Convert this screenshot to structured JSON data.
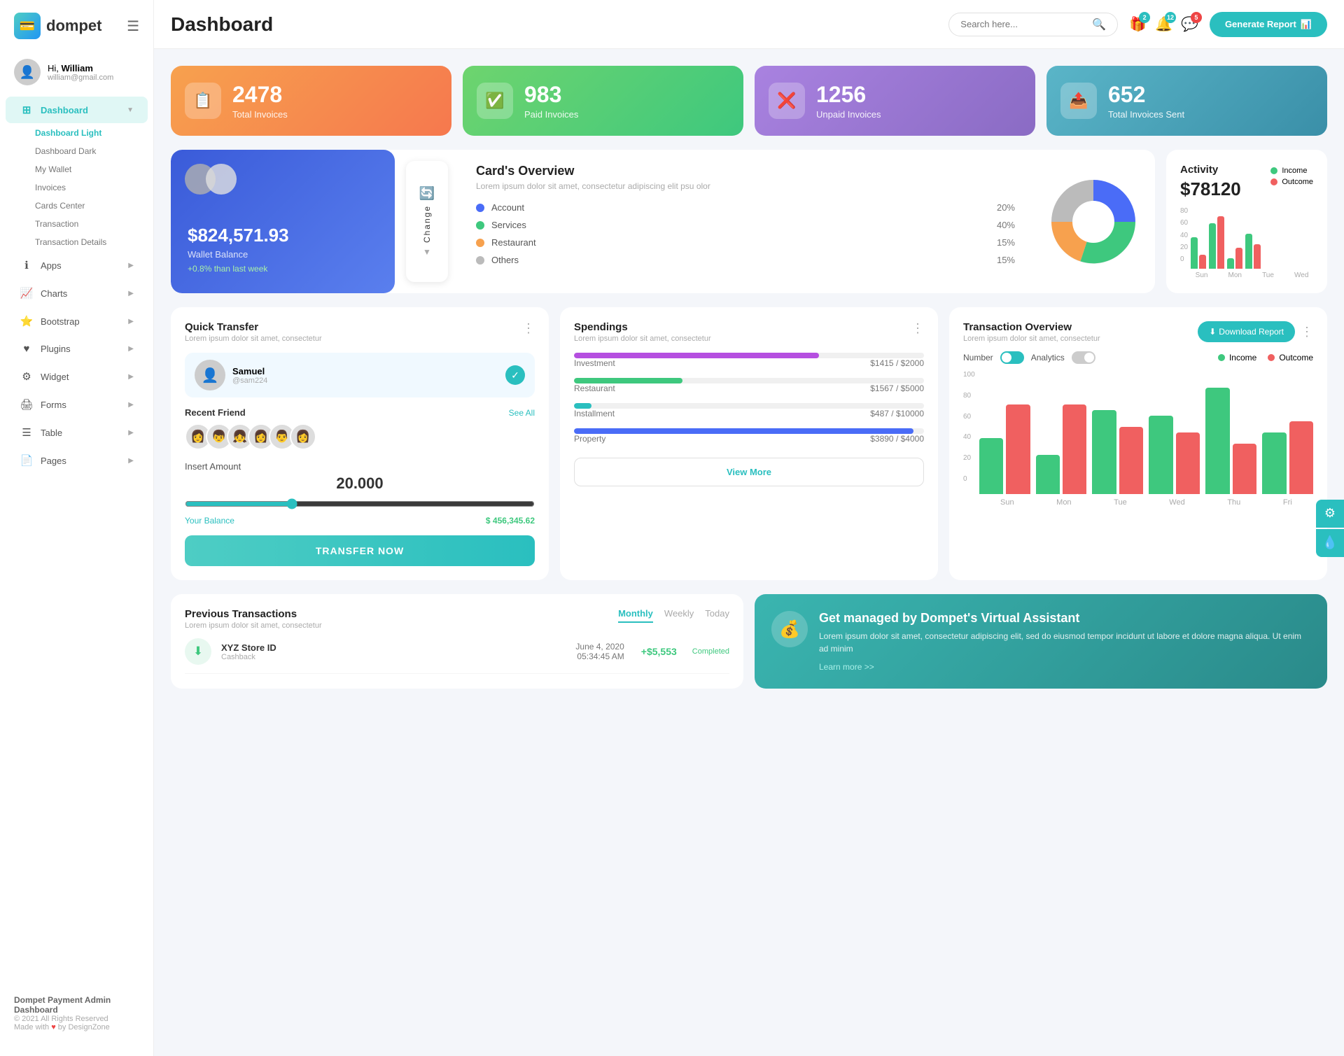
{
  "logo": {
    "text": "dompet",
    "icon": "💳"
  },
  "hamburger": "☰",
  "user": {
    "greeting": "Hi,",
    "name": "William",
    "email": "william@gmail.com",
    "avatar": "👤"
  },
  "sidebar": {
    "nav": [
      {
        "id": "dashboard",
        "label": "Dashboard",
        "icon": "⊞",
        "active": true,
        "arrow": "▼"
      },
      {
        "id": "dashboard-light",
        "label": "Dashboard Light",
        "sub": true,
        "active": true
      },
      {
        "id": "dashboard-dark",
        "label": "Dashboard Dark",
        "sub": true
      },
      {
        "id": "my-wallet",
        "label": "My Wallet",
        "sub": true
      },
      {
        "id": "invoices",
        "label": "Invoices",
        "sub": true
      },
      {
        "id": "cards-center",
        "label": "Cards Center",
        "sub": true
      },
      {
        "id": "transaction",
        "label": "Transaction",
        "sub": true
      },
      {
        "id": "transaction-details",
        "label": "Transaction Details",
        "sub": true
      },
      {
        "id": "apps",
        "label": "Apps",
        "icon": "ℹ",
        "arrow": "▶"
      },
      {
        "id": "charts",
        "label": "Charts",
        "icon": "📈",
        "arrow": "▶"
      },
      {
        "id": "bootstrap",
        "label": "Bootstrap",
        "icon": "⭐",
        "arrow": "▶"
      },
      {
        "id": "plugins",
        "label": "Plugins",
        "icon": "♥",
        "arrow": "▶"
      },
      {
        "id": "widget",
        "label": "Widget",
        "icon": "⚙",
        "arrow": "▶"
      },
      {
        "id": "forms",
        "label": "Forms",
        "icon": "🖨",
        "arrow": "▶"
      },
      {
        "id": "table",
        "label": "Table",
        "icon": "☰",
        "arrow": "▶"
      },
      {
        "id": "pages",
        "label": "Pages",
        "icon": "📄",
        "arrow": "▶"
      }
    ],
    "footer": {
      "title": "Dompet Payment Admin Dashboard",
      "copy": "© 2021 All Rights Reserved",
      "made": "Made with",
      "heart": "♥",
      "by": "by DesignZone"
    }
  },
  "topbar": {
    "title": "Dashboard",
    "search_placeholder": "Search here...",
    "search_icon": "🔍",
    "icons": [
      {
        "id": "gift",
        "icon": "🎁",
        "badge": "2",
        "badge_type": "teal"
      },
      {
        "id": "bell",
        "icon": "🔔",
        "badge": "12",
        "badge_type": "teal"
      },
      {
        "id": "chat",
        "icon": "💬",
        "badge": "5",
        "badge_type": "red"
      }
    ],
    "generate_btn": "Generate Report",
    "generate_icon": "📊"
  },
  "stats": [
    {
      "id": "total-invoices",
      "number": "2478",
      "label": "Total Invoices",
      "icon": "📋",
      "color": "orange"
    },
    {
      "id": "paid-invoices",
      "number": "983",
      "label": "Paid Invoices",
      "icon": "✅",
      "color": "green"
    },
    {
      "id": "unpaid-invoices",
      "number": "1256",
      "label": "Unpaid Invoices",
      "icon": "❌",
      "color": "purple"
    },
    {
      "id": "total-sent",
      "number": "652",
      "label": "Total Invoices Sent",
      "icon": "📤",
      "color": "teal"
    }
  ],
  "wallet": {
    "amount": "$824,571.93",
    "label": "Wallet Balance",
    "trend": "+0.8% than last week",
    "change_btn": "Change"
  },
  "cards_overview": {
    "title": "Card's Overview",
    "desc": "Lorem ipsum dolor sit amet, consectetur adipiscing elit psu olor",
    "items": [
      {
        "label": "Account",
        "pct": "20%",
        "color": "blue"
      },
      {
        "label": "Services",
        "pct": "40%",
        "color": "green"
      },
      {
        "label": "Restaurant",
        "pct": "15%",
        "color": "orange"
      },
      {
        "label": "Others",
        "pct": "15%",
        "color": "gray"
      }
    ]
  },
  "activity": {
    "title": "Activity",
    "amount": "$78120",
    "income_label": "Income",
    "outcome_label": "Outcome",
    "bars": [
      {
        "day": "Sun",
        "income": 45,
        "outcome": 20
      },
      {
        "day": "Mon",
        "income": 65,
        "outcome": 75
      },
      {
        "day": "Tue",
        "income": 15,
        "outcome": 30
      },
      {
        "day": "Wed",
        "income": 50,
        "outcome": 35
      }
    ],
    "y_labels": [
      "80",
      "60",
      "40",
      "20",
      "0"
    ]
  },
  "quick_transfer": {
    "title": "Quick Transfer",
    "desc": "Lorem ipsum dolor sit amet, consectetur",
    "user": {
      "name": "Samuel",
      "id": "@sam224",
      "avatar": "👤"
    },
    "recent_friends_label": "Recent Friend",
    "see_more": "See All",
    "friends": [
      "👩",
      "👦",
      "👧",
      "👩",
      "👨",
      "👩"
    ],
    "insert_amount_label": "Insert Amount",
    "amount": "20.000",
    "balance_label": "Your Balance",
    "balance_value": "$ 456,345.62",
    "transfer_btn": "TRANSFER NOW"
  },
  "spendings": {
    "title": "Spendings",
    "desc": "Lorem ipsum dolor sit amet, consectetur",
    "items": [
      {
        "label": "Investment",
        "amount": "$1415",
        "max": "$2000",
        "pct": 70,
        "color": "#b54fe0"
      },
      {
        "label": "Restaurant",
        "amount": "$1567",
        "max": "$5000",
        "pct": 31,
        "color": "#3ec87e"
      },
      {
        "label": "Installment",
        "amount": "$487",
        "max": "$10000",
        "pct": 5,
        "color": "#2abfbf"
      },
      {
        "label": "Property",
        "amount": "$3890",
        "max": "$4000",
        "pct": 97,
        "color": "#4a6cf7"
      }
    ],
    "view_more": "View More"
  },
  "transaction_overview": {
    "title": "Transaction Overview",
    "desc": "Lorem ipsum dolor sit amet, consectetur",
    "download_btn": "Download Report",
    "number_label": "Number",
    "analytics_label": "Analytics",
    "income_label": "Income",
    "outcome_label": "Outcome",
    "bars": [
      {
        "day": "Sun",
        "income": 50,
        "outcome": 80
      },
      {
        "day": "Mon",
        "income": 35,
        "outcome": 80
      },
      {
        "day": "Tue",
        "income": 75,
        "outcome": 60
      },
      {
        "day": "Wed",
        "income": 70,
        "outcome": 55
      },
      {
        "day": "Thu",
        "income": 95,
        "outcome": 45
      },
      {
        "day": "Fri",
        "income": 55,
        "outcome": 65
      }
    ],
    "y_labels": [
      "100",
      "80",
      "60",
      "40",
      "20",
      "0"
    ]
  },
  "prev_transactions": {
    "title": "Previous Transactions",
    "desc": "Lorem ipsum dolor sit amet, consectetur",
    "tabs": [
      "Monthly",
      "Weekly",
      "Today"
    ],
    "active_tab": "Monthly",
    "rows": [
      {
        "name": "XYZ Store ID",
        "type": "Cashback",
        "date": "June 4, 2020",
        "time": "05:34:45 AM",
        "amount": "+$5,553",
        "status": "Completed",
        "icon": "⬇"
      }
    ]
  },
  "virtual_assistant": {
    "title": "Get managed by Dompet's Virtual Assistant",
    "desc": "Lorem ipsum dolor sit amet, consectetur adipiscing elit, sed do eiusmod tempor incidunt ut labore et dolore magna aliqua. Ut enim ad minim",
    "link": "Learn more >>",
    "icon": "💰"
  },
  "float_btns": [
    {
      "id": "settings",
      "icon": "⚙"
    },
    {
      "id": "water",
      "icon": "💧"
    }
  ]
}
